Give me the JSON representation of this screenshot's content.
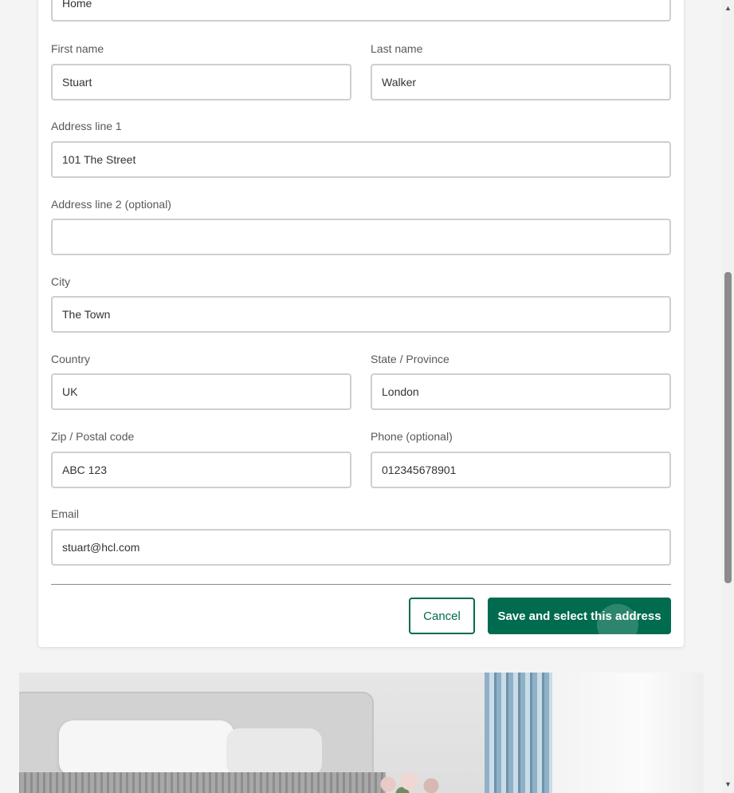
{
  "form": {
    "nickname": {
      "value": "Home"
    },
    "first_name": {
      "label": "First name",
      "value": "Stuart"
    },
    "last_name": {
      "label": "Last name",
      "value": "Walker"
    },
    "address_line_1": {
      "label": "Address line 1",
      "value": "101 The Street"
    },
    "address_line_2": {
      "label": "Address line 2 (optional)",
      "value": ""
    },
    "city": {
      "label": "City",
      "value": "The Town"
    },
    "country": {
      "label": "Country",
      "value": "UK"
    },
    "state": {
      "label": "State / Province",
      "value": "London"
    },
    "zip": {
      "label": "Zip / Postal code",
      "value": "ABC 123"
    },
    "phone": {
      "label": "Phone (optional)",
      "value": "012345678901"
    },
    "email": {
      "label": "Email",
      "value": "stuart@hcl.com"
    }
  },
  "actions": {
    "cancel_label": "Cancel",
    "save_label": "Save and select this address"
  },
  "scrollbar": {
    "up_icon": "triangle-up-icon",
    "down_icon": "triangle-down-icon"
  },
  "colors": {
    "brand": "#006b4f",
    "page_background": "#f4f4f4",
    "input_border": "#cfcfcf"
  }
}
